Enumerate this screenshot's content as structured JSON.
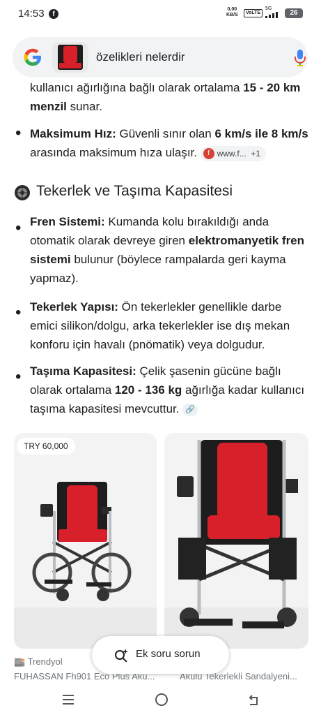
{
  "status": {
    "time": "14:53",
    "speed_value": "0,00",
    "speed_unit": "KB/S",
    "volte": "VoLTE",
    "network": "5G",
    "battery": "26"
  },
  "search": {
    "query": "özelikleri nelerdir"
  },
  "content": {
    "p1": {
      "pre": "kullanıcı ağırlığına bağlı olarak ortalama ",
      "b1": "15 - 20 km menzil",
      "post": " sunar."
    },
    "p2": {
      "b1": "Maksimum Hız:",
      "mid1": " Güvenli sınır olan ",
      "b2": "6 km/s ile 8 km/s",
      "mid2": " arasında maksimum hıza ulaşır.",
      "chip_text": "www.f...",
      "chip_more": "+1"
    },
    "heading": "Tekerlek ve Taşıma Kapasitesi",
    "p3": {
      "b1": "Fren Sistemi:",
      "mid1": " Kumanda kolu bırakıldığı anda otomatik olarak devreye giren ",
      "b2": "elektromanyetik fren sistemi",
      "mid2": " bulunur (böylece rampalarda geri kayma yapmaz)."
    },
    "p4": {
      "b1": "Tekerlek Yapısı:",
      "mid1": " Ön tekerlekler genellikle darbe emici silikon/dolgu, arka tekerlekler ise dış mekan konforu için havalı (pnömatik) veya dolgudur."
    },
    "p5": {
      "b1": "Taşıma Kapasitesi:",
      "mid1": " Çelik şasenin gücüne bağlı olarak ortalama ",
      "b2": "120 - 136 kg",
      "mid2": " ağırlığa kadar kullanıcı taşıma kapasitesi mevcuttur."
    }
  },
  "products": [
    {
      "price": "TRY 60,000",
      "source": "Trendyol",
      "title": "FUHASSAN Fh901 Eco Plus Akü..."
    },
    {
      "title": "Akülü Tekerlekli Sandalyeni..."
    }
  ],
  "ask_button": {
    "label": "Ek soru sorun"
  },
  "colors": {
    "accent_red": "#d8202a",
    "chair_black": "#1d1d1d",
    "frame": "#b9bcc0"
  }
}
